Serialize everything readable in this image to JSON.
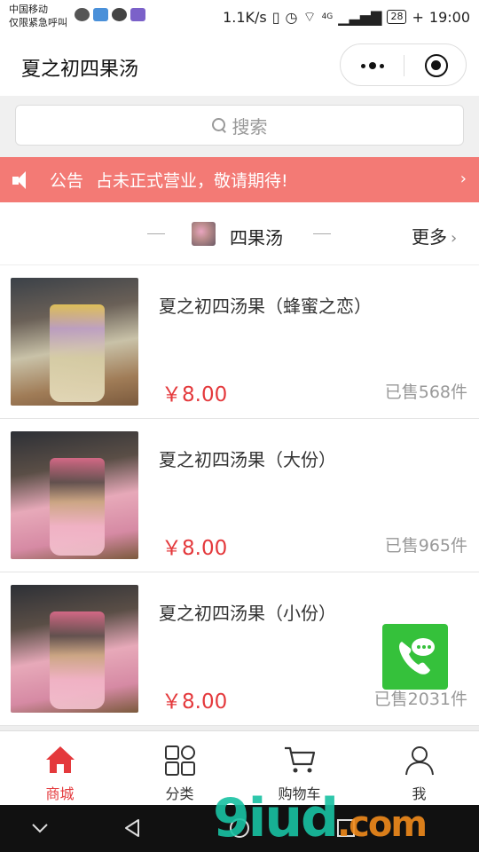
{
  "status_bar": {
    "carrier_line1": "中国移动",
    "carrier_line2": "仅限紧急呼叫",
    "net_speed": "1.1K/s",
    "network": "4G",
    "battery": "28",
    "time": "19:00"
  },
  "header": {
    "title": "夏之初四果汤"
  },
  "search": {
    "placeholder": "搜索"
  },
  "notice": {
    "label": "公告",
    "text": "占未正式营业，敬请期待!"
  },
  "section": {
    "title": "四果汤",
    "more_label": "更多"
  },
  "products": [
    {
      "name": "夏之初四汤果（蜂蜜之恋）",
      "price": "￥8.00",
      "sold": "已售568件"
    },
    {
      "name": "夏之初四汤果（大份）",
      "price": "￥8.00",
      "sold": "已售965件"
    },
    {
      "name": "夏之初四汤果（小份）",
      "price": "￥8.00",
      "sold": "已售2031件"
    }
  ],
  "tabs": [
    {
      "label": "商城",
      "icon": "home-icon",
      "active": true
    },
    {
      "label": "分类",
      "icon": "category-icon",
      "active": false
    },
    {
      "label": "购物车",
      "icon": "cart-icon",
      "active": false
    },
    {
      "label": "我",
      "icon": "user-icon",
      "active": false
    }
  ],
  "watermark": {
    "text": "9iud",
    "suffix": ".com"
  },
  "colors": {
    "accent": "#e4393c",
    "notice_bg": "#f37a75",
    "contact_green": "#35c13b"
  }
}
